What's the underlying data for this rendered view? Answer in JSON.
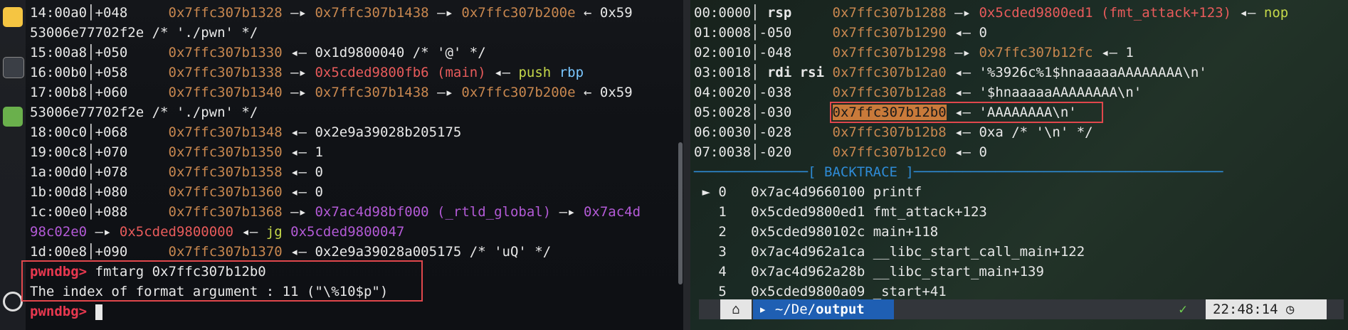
{
  "left_pane": {
    "stack_lines": [
      {
        "idx": "14:00a0",
        "off": "+048",
        "a": "0x7ffc307b1328",
        "p1": "0x7ffc307b1438",
        "p2": "0x7ffc307b200e",
        "tail": "0x59"
      },
      {
        "cont": "53006e77702f2e /* './pwn' */"
      },
      {
        "idx": "15:00a8",
        "off": "+050",
        "a": "0x7ffc307b1330",
        "val": "0x1d9800040 /* '@' */"
      },
      {
        "idx": "16:00b0",
        "off": "+058",
        "a": "0x7ffc307b1338",
        "code": "0x5cded9800fb6 (main)",
        "insn": "push",
        "reg": "rbp"
      },
      {
        "idx": "17:00b8",
        "off": "+060",
        "a": "0x7ffc307b1340",
        "p1": "0x7ffc307b1438",
        "p2": "0x7ffc307b200e",
        "tail": "0x59"
      },
      {
        "cont": "53006e77702f2e /* './pwn' */"
      },
      {
        "idx": "18:00c0",
        "off": "+068",
        "a": "0x7ffc307b1348",
        "val": "0x2e9a39028b205175"
      },
      {
        "idx": "19:00c8",
        "off": "+070",
        "a": "0x7ffc307b1350",
        "val": "1"
      },
      {
        "idx": "1a:00d0",
        "off": "+078",
        "a": "0x7ffc307b1358",
        "val": "0"
      },
      {
        "idx": "1b:00d8",
        "off": "+080",
        "a": "0x7ffc307b1360",
        "val": "0"
      },
      {
        "idx": "1c:00e0",
        "off": "+088",
        "a": "0x7ffc307b1368",
        "lib": "0x7ac4d98bf000 (_rtld_global)",
        "lib2": "0x7ac4d"
      },
      {
        "cont_lib": "98c02e0",
        "code": "0x5cded9800000",
        "insn": "jg",
        "lib3": "0x5cded9800047"
      },
      {
        "idx": "1d:00e8",
        "off": "+090",
        "a": "0x7ffc307b1370",
        "val": "0x2e9a39028a005175 /* 'uQ' */"
      }
    ],
    "prompt": "pwndbg>",
    "command": "fmtarg 0x7ffc307b12b0",
    "result": "The index of format argument : 11 (\"\\%10$p\")"
  },
  "right_pane": {
    "stack": [
      {
        "idx": "00:0000",
        "reg": "rsp",
        "a": "0x7ffc307b1288",
        "code": "0x5cded9800ed1 (fmt_attack+123)",
        "insn": "nop"
      },
      {
        "idx": "01:0008",
        "off": "-050",
        "a": "0x7ffc307b1290",
        "val": "0"
      },
      {
        "idx": "02:0010",
        "off": "-048",
        "a": "0x7ffc307b1298",
        "p1": "0x7ffc307b12fc",
        "val": "1"
      },
      {
        "idx": "03:0018",
        "reg": "rdi rsi",
        "a": "0x7ffc307b12a0",
        "val": "'%3926c%1$hnaaaaaAAAAAAAA\\n'"
      },
      {
        "idx": "04:0020",
        "off": "-038",
        "a": "0x7ffc307b12a8",
        "val": "'$hnaaaaaAAAAAAAA\\n'"
      },
      {
        "idx": "05:0028",
        "off": "-030",
        "a": "0x7ffc307b12b0",
        "val": "'AAAAAAAA\\n'"
      },
      {
        "idx": "06:0030",
        "off": "-028",
        "a": "0x7ffc307b12b8",
        "val": "0xa /* '\\n' */"
      },
      {
        "idx": "07:0038",
        "off": "-020",
        "a": "0x7ffc307b12c0",
        "val": "0"
      }
    ],
    "backtrace_title": "[ BACKTRACE ]",
    "backtrace": [
      {
        "n": "0",
        "addr": "0x7ac4d9660100",
        "sym": "printf",
        "current": true
      },
      {
        "n": "1",
        "addr": "0x5cded9800ed1",
        "sym": "fmt_attack+123"
      },
      {
        "n": "2",
        "addr": "0x5cded980102c",
        "sym": "main+118"
      },
      {
        "n": "3",
        "addr": "0x7ac4d962a1ca",
        "sym": "__libc_start_call_main+122"
      },
      {
        "n": "4",
        "addr": "0x7ac4d962a28b",
        "sym": "__libc_start_main+139"
      },
      {
        "n": "5",
        "addr": "0x5cded9800a09",
        "sym": "_start+41"
      }
    ],
    "status": {
      "os_glyph": "⌂",
      "path_prefix": "~/De/",
      "path_current": "output",
      "check": "✓",
      "time": "22:48:14",
      "clock_glyph": "◷"
    }
  },
  "colors": {
    "address": "#c8874f",
    "code_pointer": "#e85b5b",
    "lib_pointer": "#b35ad6",
    "instruction": "#c6d94a",
    "register": "#7ac7ff",
    "prompt": "#e8384f",
    "highlight_box": "#e0474c",
    "backtrace": "#2e8bd6"
  }
}
